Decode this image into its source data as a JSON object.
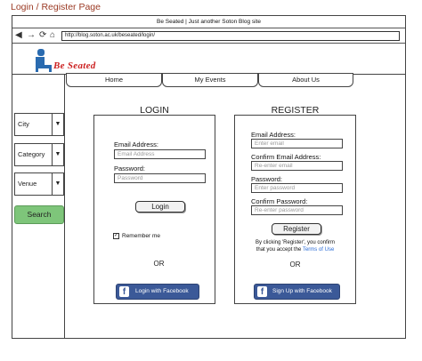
{
  "page_title": "Login / Register Page",
  "browser": {
    "window_title": "Be Seated | Just another Soton Blog site",
    "url": "http://blog.soton.ac.uk/beseated/login/",
    "nav_icons": {
      "back": "◀",
      "forward": "→",
      "reload": "⟳",
      "home": "⌂"
    }
  },
  "logo": {
    "text": "Be Seated"
  },
  "menu": {
    "home": "Home",
    "events": "My Events",
    "about": "About Us"
  },
  "sidebar": {
    "filters": [
      {
        "label": "City"
      },
      {
        "label": "Category"
      },
      {
        "label": "Venue"
      }
    ],
    "search_label": "Search"
  },
  "login": {
    "title": "LOGIN",
    "email_label": "Email Address:",
    "email_placeholder": "Email Address",
    "password_label": "Password:",
    "password_placeholder": "Password",
    "submit_label": "Login",
    "remember_label": "Remember me",
    "remember_checked": "✓",
    "or_label": "OR",
    "facebook_label": "Login with Facebook"
  },
  "register": {
    "title": "REGISTER",
    "email_label": "Email Address:",
    "email_placeholder": "Enter email",
    "confirm_email_label": "Confirm Email Address:",
    "confirm_email_placeholder": "Re-enter email",
    "password_label": "Password:",
    "password_placeholder": "Enter password",
    "confirm_password_label": "Confirm Password:",
    "confirm_password_placeholder": "Re-enter password",
    "submit_label": "Register",
    "terms_text_1": "By clicking 'Register', you confirm",
    "terms_text_2": "that you accept the",
    "terms_link": "Terms of Use",
    "or_label": "OR",
    "facebook_label": "Sign Up with Facebook"
  },
  "colors": {
    "accent_red": "#cc2222",
    "search_green": "#7ec57a",
    "facebook_blue": "#3b5998"
  }
}
